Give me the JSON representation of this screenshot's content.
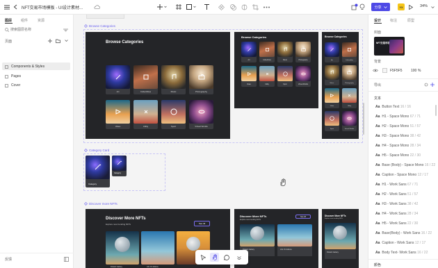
{
  "topbar": {
    "title": "NFT交易市场模板 - UI设计素材...",
    "share_label": "分享",
    "zoom": "34%"
  },
  "left": {
    "tabs": [
      "图层",
      "组件",
      "资源"
    ],
    "search_placeholder": "搜索图层名称",
    "pages_label": "页面",
    "pages": [
      "Components & Styles",
      "Pages",
      "Cover"
    ],
    "footer": "反馈"
  },
  "canvas": {
    "frames": [
      {
        "label": "Browse Categories"
      },
      {
        "label": "Category Card"
      },
      {
        "label": "Discover more NFTs"
      }
    ],
    "browse": {
      "title": "Browse Categories",
      "cats": [
        "Art",
        "Collectibles",
        "Music",
        "Photography",
        "Video",
        "Utility",
        "Sport",
        "Virtual Worlds"
      ]
    },
    "card_caption": "Category",
    "discover": {
      "title": "Discover More NFTs",
      "subtitle": "Explore new trending NFTs",
      "btn": "See All",
      "items": [
        "Distant Galaxy",
        "Life On Edena",
        "AstroFiction"
      ]
    }
  },
  "right": {
    "tabs": [
      "设计",
      "标注",
      "原型"
    ],
    "cover_label": "封面",
    "cover_title": "NFT交易市场",
    "bg_label": "背景",
    "bg_hex": "F5F5F5",
    "bg_opacity": "100",
    "bg_unit": "%",
    "export_label": "导出",
    "text_label": "文本",
    "color_label": "颜色",
    "text_styles": [
      {
        "name": "Button Text",
        "size": "16 / 16"
      },
      {
        "name": "H1 - Space Mono",
        "size": "67 / 71"
      },
      {
        "name": "H2 - Space Mono",
        "size": "51 / 57"
      },
      {
        "name": "H3 - Space Mono",
        "size": "38 / 42"
      },
      {
        "name": "H4 - Space Mono",
        "size": "28 / 34"
      },
      {
        "name": "H5 - Space Mono",
        "size": "22 / 30"
      },
      {
        "name": "Base (Body) - Space Mono",
        "size": "16 / 22"
      },
      {
        "name": "Caption - Space Mono",
        "size": "12 / 17"
      },
      {
        "name": "H1 - Work Sans",
        "size": "67 / 71"
      },
      {
        "name": "H2 - Work Sans",
        "size": "51 / 57"
      },
      {
        "name": "H3 - Work Sans",
        "size": "38 / 42"
      },
      {
        "name": "H4 - Work Sans",
        "size": "28 / 34"
      },
      {
        "name": "H5 - Work Sans",
        "size": "22 / 30"
      },
      {
        "name": "Base(Body) - Work Sans",
        "size": "16 / 22"
      },
      {
        "name": "Caption - Work Sans",
        "size": "12 / 17"
      },
      {
        "name": "Body Text- Work Sans",
        "size": "16 / 22"
      }
    ]
  },
  "colors": {
    "accent": "#6b62f0",
    "share": "#4e49e6",
    "dark": "#242528"
  }
}
